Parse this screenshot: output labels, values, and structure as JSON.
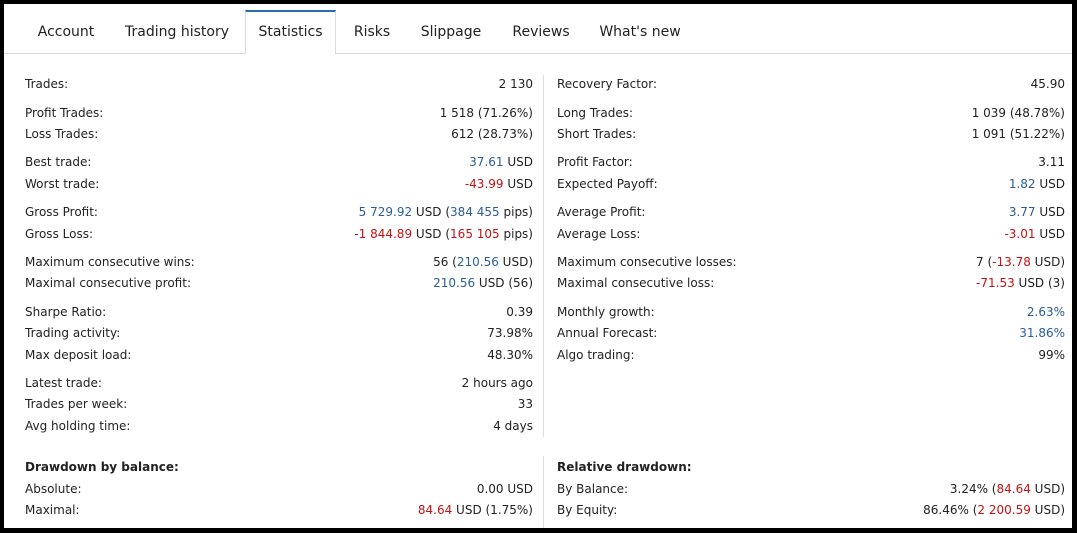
{
  "tabs": [
    {
      "label": "Account"
    },
    {
      "label": "Trading history"
    },
    {
      "label": "Statistics"
    },
    {
      "label": "Risks"
    },
    {
      "label": "Slippage"
    },
    {
      "label": "Reviews"
    },
    {
      "label": "What's new"
    }
  ],
  "colors": {
    "accent": "#2a6db5",
    "positive": "#2a5d9a",
    "negative": "#c41313"
  },
  "left": {
    "trades": {
      "label": "Trades:",
      "value": "2 130"
    },
    "profit_trades": {
      "label": "Profit Trades:",
      "value": "1 518 (71.26%)"
    },
    "loss_trades": {
      "label": "Loss Trades:",
      "value": "612 (28.73%)"
    },
    "best_trade": {
      "label": "Best trade:",
      "num": "37.61",
      "unit": " USD"
    },
    "worst_trade": {
      "label": "Worst trade:",
      "num": "-43.99",
      "unit": " USD"
    },
    "gross_profit": {
      "label": "Gross Profit:",
      "num": "5 729.92",
      "mid": " USD (",
      "pips": "384 455",
      "end": " pips)"
    },
    "gross_loss": {
      "label": "Gross Loss:",
      "num": "-1 844.89",
      "mid": " USD (",
      "pips": "165 105",
      "end": " pips)"
    },
    "max_consec_wins": {
      "label": "Maximum consecutive wins:",
      "pre": "56 (",
      "num": "210.56",
      "end": " USD)"
    },
    "max_consec_profit": {
      "label": "Maximal consecutive profit:",
      "num": "210.56",
      "end": " USD (56)"
    },
    "sharpe": {
      "label": "Sharpe Ratio:",
      "value": "0.39"
    },
    "trading_activity": {
      "label": "Trading activity:",
      "value": "73.98%"
    },
    "max_deposit_load": {
      "label": "Max deposit load:",
      "value": "48.30%"
    },
    "latest_trade": {
      "label": "Latest trade:",
      "value": "2 hours ago"
    },
    "trades_per_week": {
      "label": "Trades per week:",
      "value": "33"
    },
    "avg_holding": {
      "label": "Avg holding time:",
      "value": "4 days"
    },
    "drawdown_title": "Drawdown by balance:",
    "absolute": {
      "label": "Absolute:",
      "value": "0.00 USD"
    },
    "maximal": {
      "label": "Maximal:",
      "num": "84.64",
      "end": " USD (1.75%)"
    }
  },
  "right": {
    "recovery_factor": {
      "label": "Recovery Factor:",
      "value": "45.90"
    },
    "long_trades": {
      "label": "Long Trades:",
      "value": "1 039 (48.78%)"
    },
    "short_trades": {
      "label": "Short Trades:",
      "value": "1 091 (51.22%)"
    },
    "profit_factor": {
      "label": "Profit Factor:",
      "value": "3.11"
    },
    "expected_payoff": {
      "label": "Expected Payoff:",
      "num": "1.82",
      "unit": " USD"
    },
    "average_profit": {
      "label": "Average Profit:",
      "num": "3.77",
      "unit": " USD"
    },
    "average_loss": {
      "label": "Average Loss:",
      "num": "-3.01",
      "unit": " USD"
    },
    "max_consec_losses": {
      "label": "Maximum consecutive losses:",
      "pre": "7 (",
      "num": "-13.78",
      "end": " USD)"
    },
    "max_consec_loss": {
      "label": "Maximal consecutive loss:",
      "num": "-71.53",
      "end": " USD (3)"
    },
    "monthly_growth": {
      "label": "Monthly growth:",
      "num": "2.63%"
    },
    "annual_forecast": {
      "label": "Annual Forecast:",
      "num": "31.86%"
    },
    "algo_trading": {
      "label": "Algo trading:",
      "value": "99%"
    },
    "relative_title": "Relative drawdown:",
    "by_balance": {
      "label": "By Balance:",
      "pre": "3.24% (",
      "num": "84.64",
      "end": " USD)"
    },
    "by_equity": {
      "label": "By Equity:",
      "pre": "86.46% (",
      "num": "2 200.59",
      "end": " USD)"
    }
  }
}
